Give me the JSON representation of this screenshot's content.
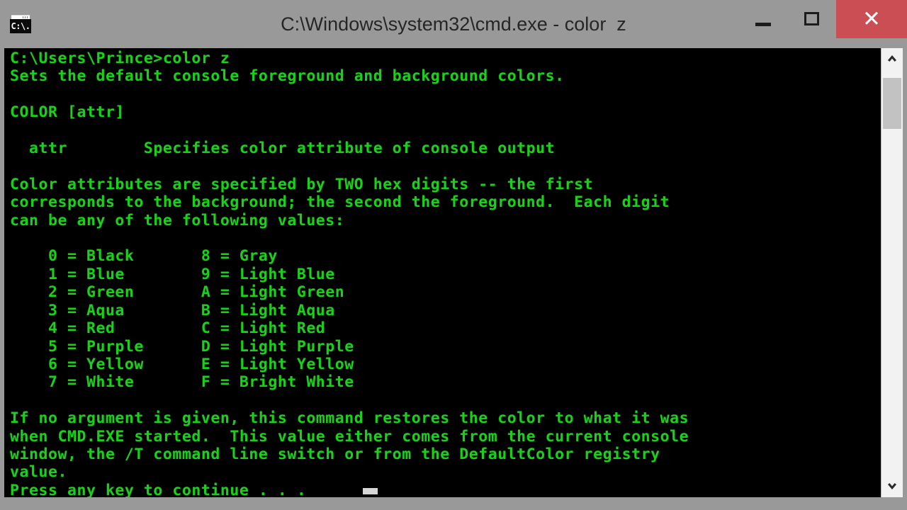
{
  "window": {
    "title": "C:\\Windows\\system32\\cmd.exe - color  z",
    "icon_label": "C:\\.",
    "icon_name": "cmd-console-icon",
    "titlebar_color": "#999999",
    "close_button_color": "#cb4e54"
  },
  "controls": {
    "minimize_label": "",
    "maximize_label": "",
    "close_label": "✕"
  },
  "console": {
    "foreground_color": "#1ad01a",
    "background_color": "#000000",
    "prompt": "C:\\Users\\Prince>",
    "command": "color z",
    "lines": [
      "C:\\Users\\Prince>color z",
      "Sets the default console foreground and background colors.",
      "",
      "COLOR [attr]",
      "",
      "  attr        Specifies color attribute of console output",
      "",
      "Color attributes are specified by TWO hex digits -- the first",
      "corresponds to the background; the second the foreground.  Each digit",
      "can be any of the following values:",
      "",
      "    0 = Black       8 = Gray",
      "    1 = Blue        9 = Light Blue",
      "    2 = Green       A = Light Green",
      "    3 = Aqua        B = Light Aqua",
      "    4 = Red         C = Light Red",
      "    5 = Purple      D = Light Purple",
      "    6 = Yellow      E = Light Yellow",
      "    7 = White       F = Bright White",
      "",
      "If no argument is given, this command restores the color to what it was",
      "when CMD.EXE started.  This value either comes from the current console",
      "window, the /T command line switch or from the DefaultColor registry",
      "value.",
      "Press any key to continue . . ."
    ],
    "color_table": {
      "left": [
        {
          "code": "0",
          "name": "Black"
        },
        {
          "code": "1",
          "name": "Blue"
        },
        {
          "code": "2",
          "name": "Green"
        },
        {
          "code": "3",
          "name": "Aqua"
        },
        {
          "code": "4",
          "name": "Red"
        },
        {
          "code": "5",
          "name": "Purple"
        },
        {
          "code": "6",
          "name": "Yellow"
        },
        {
          "code": "7",
          "name": "White"
        }
      ],
      "right": [
        {
          "code": "8",
          "name": "Gray"
        },
        {
          "code": "9",
          "name": "Light Blue"
        },
        {
          "code": "A",
          "name": "Light Green"
        },
        {
          "code": "B",
          "name": "Light Aqua"
        },
        {
          "code": "C",
          "name": "Light Red"
        },
        {
          "code": "D",
          "name": "Light Purple"
        },
        {
          "code": "E",
          "name": "Light Yellow"
        },
        {
          "code": "F",
          "name": "Bright White"
        }
      ]
    },
    "status_line": "Press any key to continue . . ."
  },
  "scrollbar": {
    "up_arrow": "▲",
    "down_arrow": "▼",
    "thumb_top_pct": 6,
    "thumb_height_pct": 11
  }
}
